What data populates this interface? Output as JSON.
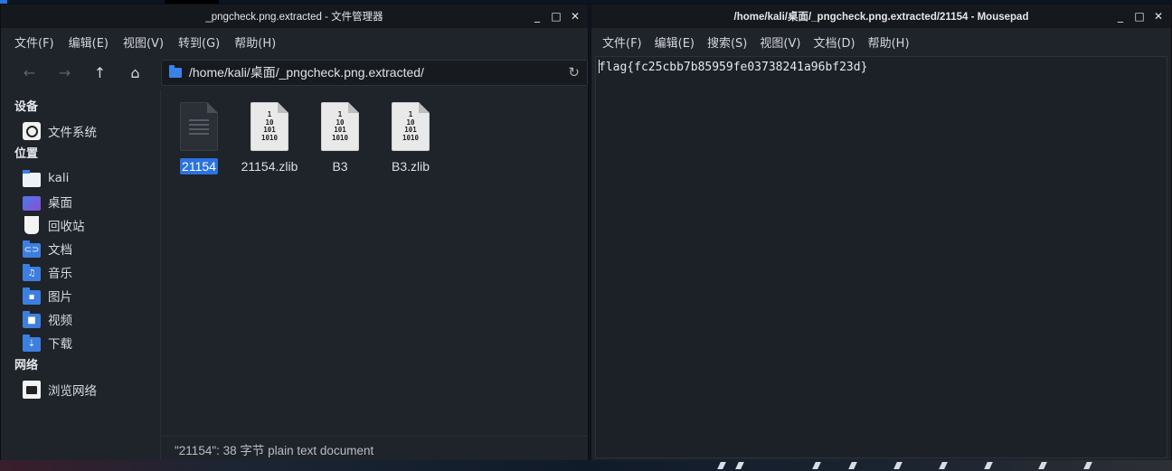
{
  "file_manager": {
    "title": "_pngcheck.png.extracted - 文件管理器",
    "window_controls": {
      "minimize": "_",
      "maximize": "□",
      "close": "✕"
    },
    "menu": [
      "文件(F)",
      "编辑(E)",
      "视图(V)",
      "转到(G)",
      "帮助(H)"
    ],
    "nav": {
      "back_icon": "←",
      "forward_icon": "→",
      "up_icon": "↑",
      "home_icon": "⌂",
      "reload_icon": "↻"
    },
    "path": "/home/kali/桌面/_pngcheck.png.extracted/",
    "sidebar": {
      "devices_heading": "设备",
      "devices": [
        {
          "label": "文件系统",
          "icon": "disk-icon"
        }
      ],
      "places_heading": "位置",
      "places": [
        {
          "label": "kali",
          "icon": "home-folder-icon"
        },
        {
          "label": "桌面",
          "icon": "desktop-icon"
        },
        {
          "label": "回收站",
          "icon": "trash-icon"
        },
        {
          "label": "文档",
          "icon": "documents-folder-icon",
          "glyph": "⊂⊃"
        },
        {
          "label": "音乐",
          "icon": "music-folder-icon",
          "glyph": "♫"
        },
        {
          "label": "图片",
          "icon": "pictures-folder-icon",
          "glyph": "▪"
        },
        {
          "label": "视频",
          "icon": "videos-folder-icon",
          "glyph": "■"
        },
        {
          "label": "下载",
          "icon": "downloads-folder-icon",
          "glyph": "⇣"
        }
      ],
      "network_heading": "网络",
      "network": [
        {
          "label": "浏览网络",
          "icon": "network-icon"
        }
      ]
    },
    "files": [
      {
        "name": "21154",
        "type": "text",
        "selected": true
      },
      {
        "name": "21154.zlib",
        "type": "binary",
        "glyph": "1\n10\n101\n1010"
      },
      {
        "name": "B3",
        "type": "binary",
        "glyph": "1\n10\n101\n1010"
      },
      {
        "name": "B3.zlib",
        "type": "binary",
        "glyph": "1\n10\n101\n1010"
      }
    ],
    "status": "\"21154\": 38 字节 plain text document"
  },
  "mousepad": {
    "title": "/home/kali/桌面/_pngcheck.png.extracted/21154 - Mousepad",
    "window_controls": {
      "minimize": "_",
      "maximize": "□",
      "close": "✕"
    },
    "menu": [
      "文件(F)",
      "编辑(E)",
      "搜索(S)",
      "视图(V)",
      "文档(D)",
      "帮助(H)"
    ],
    "content": "flag{fc25cbb7b85959fe03738241a96bf23d}"
  },
  "colors": {
    "selection": "#2b73de",
    "folder_blue": "#3d7fe0",
    "window_bg": "#1f232a",
    "titlebar_bg": "#15181c"
  }
}
